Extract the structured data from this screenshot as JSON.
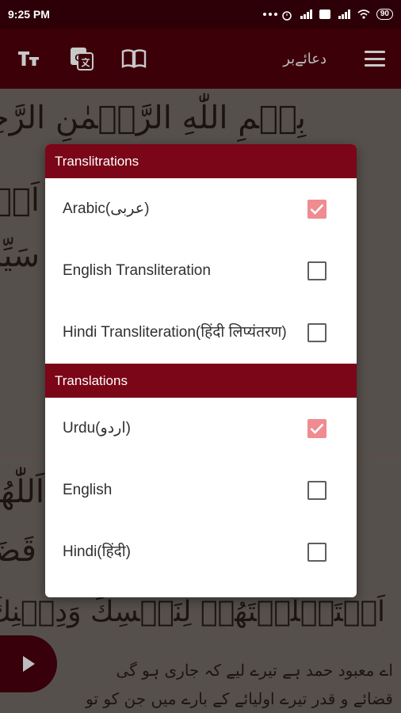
{
  "status_bar": {
    "time": "9:25 PM",
    "battery": "90"
  },
  "app_bar": {
    "title": "دعائےبر"
  },
  "background": {
    "header_calligraphy": "بِسۡمِ اللّٰهِ الرَّحۡمٰنِ الرَّحِيۡمِ",
    "verse_lines": [
      "اَلۡحَمۡدُ لِلّٰهِ",
      "سَيِّدِ",
      "اَللّٰهُمَّ",
      "قَضَا",
      "اَسۡتَخۡلَصۡتَهُمۡ لِنَفۡسِكَ وَدِيۡنِكَ"
    ],
    "urdu_lines": [
      "اے معبود حمد ہے تیرے لیے کہ جاری ہو گی",
      "قضائے و قدر تیرے اولیائے کے بارے میں جن کو تو"
    ]
  },
  "dialog": {
    "transliterations": {
      "header": "Translitrations",
      "options": [
        {
          "label": "Arabic(عربی)",
          "checked": true
        },
        {
          "label": "English Transliteration",
          "checked": false
        },
        {
          "label": "Hindi Transliteration(हिंदी लिप्यंतरण)",
          "checked": false
        }
      ]
    },
    "translations": {
      "header": "Translations",
      "options": [
        {
          "label": "Urdu(اردو)",
          "checked": true
        },
        {
          "label": "English",
          "checked": false
        },
        {
          "label": "Hindi(हिंदी)",
          "checked": false
        }
      ]
    }
  }
}
